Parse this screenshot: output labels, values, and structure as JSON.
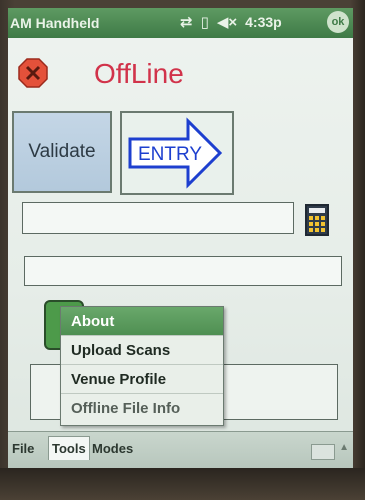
{
  "statusbar": {
    "app_title": "AM Handheld",
    "connectivity_icon": "connectivity-icon",
    "battery_icon": "battery-icon",
    "volume_icon": "volume-muted-icon",
    "clock": "4:33p",
    "ok_label": "ok"
  },
  "header": {
    "status_icon": "offline-x-icon",
    "title": "OffLine"
  },
  "buttons": {
    "validate_label": "Validate",
    "entry_label": "ENTRY"
  },
  "popup_menu": {
    "items": [
      {
        "label": "About",
        "selected": true
      },
      {
        "label": "Upload Scans"
      },
      {
        "label": "Venue Profile"
      },
      {
        "label": "Offline File Info"
      }
    ]
  },
  "menubar": {
    "file_label": "File",
    "tools_label": "Tools",
    "modes_label": "Modes"
  },
  "colors": {
    "accent_green": "#4f8f52",
    "title_red": "#d1334a",
    "entry_blue": "#1d3fcf"
  }
}
